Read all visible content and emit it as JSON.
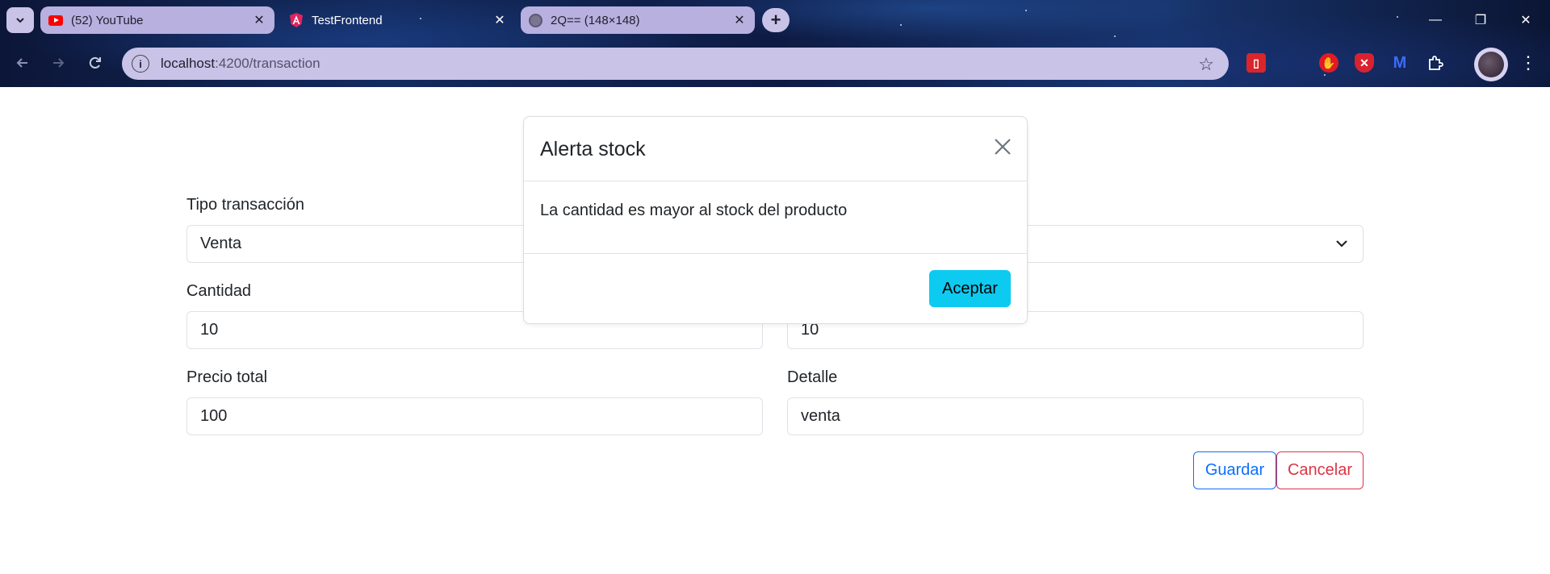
{
  "browser": {
    "tabs": [
      {
        "title": "(52) YouTube",
        "favicon": "youtube-icon",
        "active": false
      },
      {
        "title": "TestFrontend",
        "favicon": "angular-icon",
        "active": true
      },
      {
        "title": "2Q== (148×148)",
        "favicon": "globe-icon",
        "active": false
      }
    ],
    "url_host": "localhost",
    "url_path": ":4200/transaction",
    "close_glyph": "✕",
    "new_tab_glyph": "+",
    "window_controls": {
      "minimize": "—",
      "restore": "❐",
      "close": "✕"
    },
    "menu_glyph": "⋮"
  },
  "form": {
    "tipo_label": "Tipo transacción",
    "tipo_value": "Venta",
    "cantidad_label": "Cantidad",
    "cantidad_value": "10",
    "precio_unitario_value": "10",
    "precio_total_label": "Precio total",
    "precio_total_value": "100",
    "detalle_label": "Detalle",
    "detalle_value": "venta",
    "guardar_label": "Guardar",
    "cancelar_label": "Cancelar"
  },
  "modal": {
    "title": "Alerta stock",
    "body": "La cantidad es mayor al stock del producto",
    "ok_label": "Aceptar"
  },
  "colors": {
    "primary": "#0d6efd",
    "danger": "#dc3545",
    "info": "#0dcaf0",
    "tab_bg": "#b8b0df"
  }
}
